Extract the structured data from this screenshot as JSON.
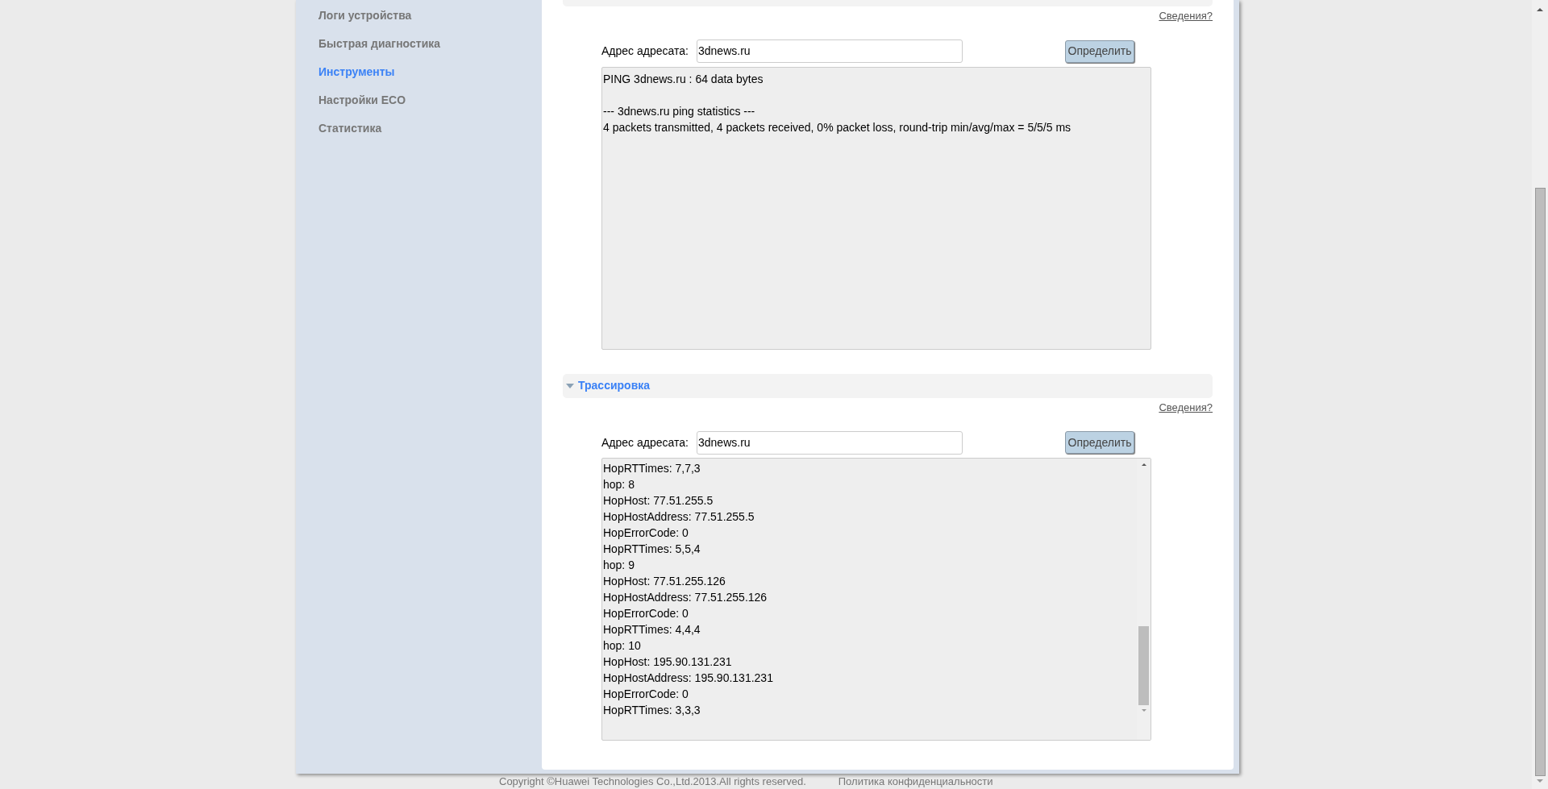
{
  "sidebar": {
    "items": [
      {
        "label": "Логи устройства",
        "selected": false
      },
      {
        "label": "Быстрая диагностика",
        "selected": false
      },
      {
        "label": "Инструменты",
        "selected": true
      },
      {
        "label": "Настройки ECO",
        "selected": false
      },
      {
        "label": "Статистика",
        "selected": false
      }
    ]
  },
  "sections": [
    {
      "help_link": "Сведения?",
      "address_label": "Адрес адресата:",
      "address_value": "3dnews.ru",
      "button": "Определить",
      "output": [
        [
          "PING 3dnews.ru : 64 data bytes"
        ],
        [
          "--- 3dnews.ru ping statistics ---",
          "4 packets transmitted, 4 packets received, 0% packet loss, round-trip min/avg/max = 5/5/5 ms"
        ]
      ],
      "scrollable": false
    },
    {
      "title": "Трассировка",
      "expanded": true,
      "help_link": "Сведения?",
      "address_label": "Адрес адресата:",
      "address_value": "3dnews.ru",
      "button": "Определить",
      "output": [
        [
          "HopRTTimes: 7,7,3",
          "hop: 8",
          "HopHost: 77.51.255.5",
          "HopHostAddress: 77.51.255.5",
          "HopErrorCode: 0",
          "HopRTTimes: 5,5,4",
          "hop: 9",
          "HopHost: 77.51.255.126",
          "HopHostAddress: 77.51.255.126",
          "HopErrorCode: 0",
          "HopRTTimes: 4,4,4",
          "hop: 10",
          "HopHost: 195.90.131.231",
          "HopHostAddress: 195.90.131.231",
          "HopErrorCode: 0",
          "HopRTTimes: 3,3,3"
        ]
      ],
      "scrollable": true
    }
  ],
  "footer": {
    "copyright": "Copyright ©Huawei Technologies Co.,Ltd.2013.All rights reserved.",
    "privacy_link": "Политика конфиденциальности"
  }
}
